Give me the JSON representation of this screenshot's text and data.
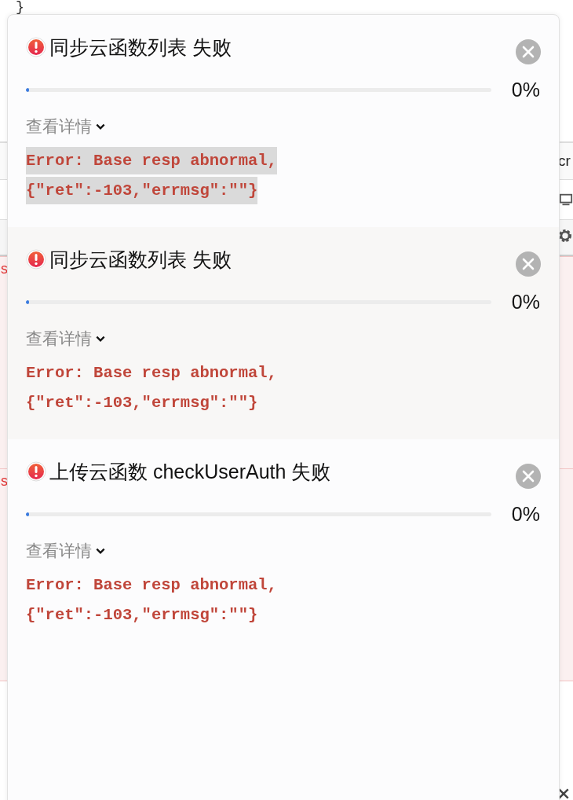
{
  "background": {
    "code_brace": "}",
    "right_fragment": "cr",
    "left_fragments": [
      "s",
      "s"
    ]
  },
  "notifications": [
    {
      "title": "同步云函数列表 失败",
      "level": 0,
      "reading": "0%",
      "details_label": "查看详情",
      "expanded": true,
      "error_lines": [
        "Error: Base resp abnormal,",
        "{\"ret\":-103,\"errmsg\":\"\"}"
      ],
      "text_selected": true,
      "highlighted": false
    },
    {
      "title": "同步云函数列表 失败",
      "level": 0,
      "reading": "0%",
      "details_label": "查看详情",
      "expanded": true,
      "error_lines": [
        "Error: Base resp abnormal,",
        "{\"ret\":-103,\"errmsg\":\"\"}"
      ],
      "text_selected": false,
      "highlighted": true
    },
    {
      "title": "上传云函数 checkUserAuth 失败",
      "level": 0,
      "reading": "0%",
      "details_label": "查看详情",
      "expanded": true,
      "error_lines": [
        "Error: Base resp abnormal,",
        "{\"ret\":-103,\"errmsg\":\"\"}"
      ],
      "text_selected": false,
      "highlighted": false
    }
  ]
}
